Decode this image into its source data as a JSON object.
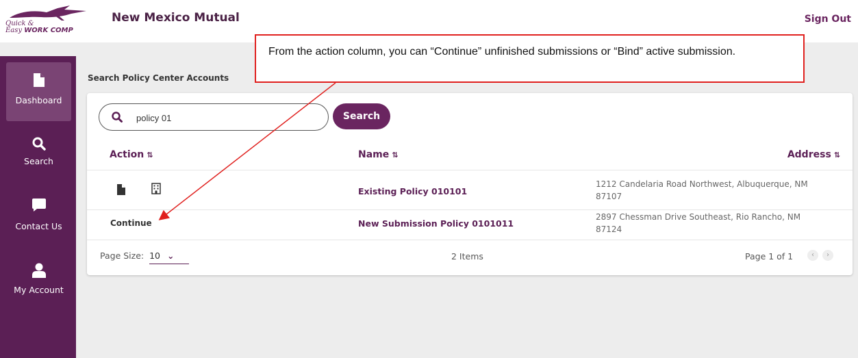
{
  "header": {
    "logo_line1": "Quick &",
    "logo_line2_script": "Easy",
    "logo_line2_bold": "WORK COMP",
    "company": "New Mexico Mutual",
    "sign_out": "Sign Out"
  },
  "sidebar": {
    "items": [
      {
        "label": "Dashboard",
        "icon": "document-icon",
        "active": true
      },
      {
        "label": "Search",
        "icon": "search-icon",
        "active": false
      },
      {
        "label": "Contact Us",
        "icon": "chat-bubble-icon",
        "active": false
      },
      {
        "label": "My Account",
        "icon": "user-icon",
        "active": false
      }
    ]
  },
  "main": {
    "section_title": "Search Policy Center Accounts",
    "search": {
      "value": "policy 01",
      "button_label": "Search"
    },
    "table": {
      "columns": [
        "Action",
        "Name",
        "Address"
      ],
      "sort_icon": "⇅",
      "rows": [
        {
          "actions": [
            "document-icon",
            "building-icon"
          ],
          "action_text": "",
          "name": "Existing Policy 010101",
          "address_line1": "1212 Candelaria Road Northwest, Albuquerque, NM",
          "address_line2": "87107"
        },
        {
          "actions": [],
          "action_text": "Continue",
          "name": "New Submission Policy 0101011",
          "address_line1": "2897 Chessman Drive Southeast, Rio Rancho, NM",
          "address_line2": "87124"
        }
      ]
    },
    "footer": {
      "page_size_label": "Page Size:",
      "page_size_value": "10",
      "items_count": "2 Items",
      "page_info": "Page 1 of 1"
    }
  },
  "annotation": {
    "text": "From the action column, you can “Continue” unfinished submissions or “Bind” active submission."
  },
  "colors": {
    "brand_purple": "#5b1f55",
    "button_purple": "#6a2560",
    "callout_red": "#e0201e"
  }
}
